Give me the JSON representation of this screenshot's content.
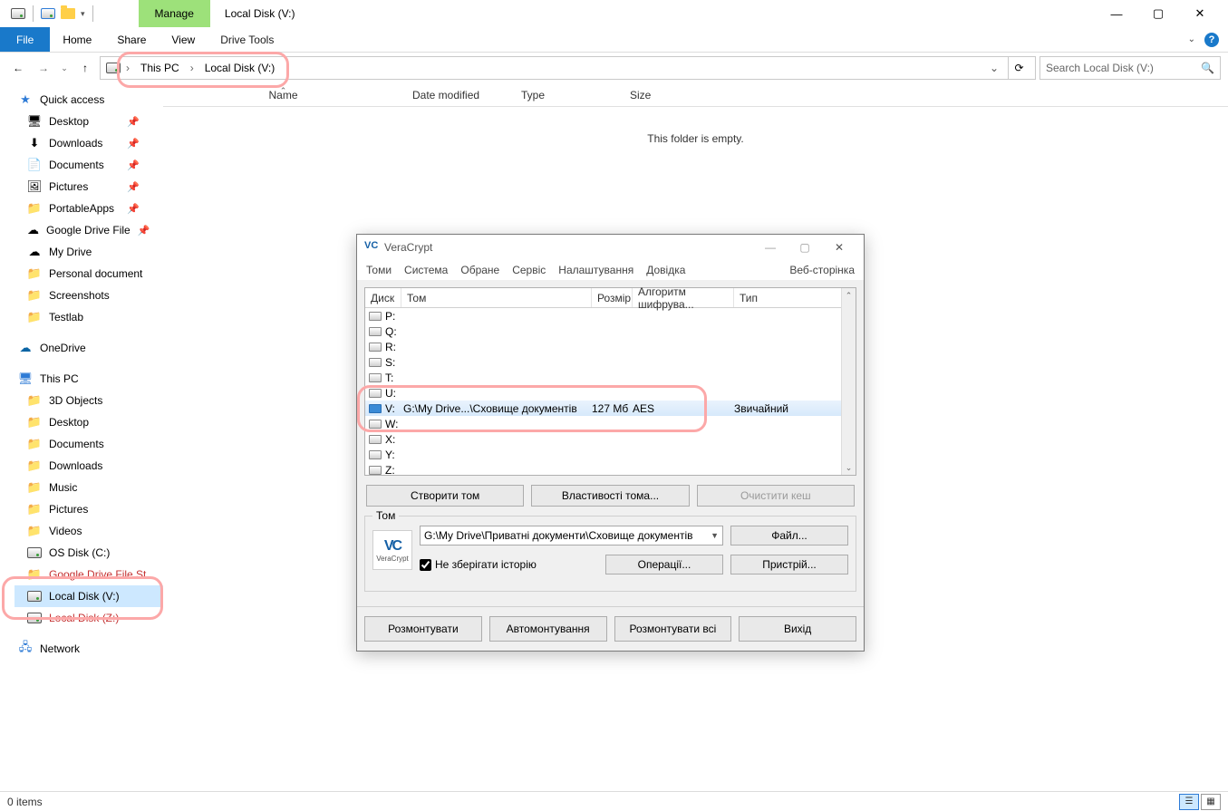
{
  "explorer": {
    "title": "Local Disk (V:)",
    "tabs": {
      "manage": "Manage",
      "file": "File",
      "home": "Home",
      "share": "Share",
      "view": "View",
      "drive_tools": "Drive Tools"
    },
    "breadcrumb": {
      "pc": "This PC",
      "vol": "Local Disk (V:)"
    },
    "search_placeholder": "Search Local Disk (V:)",
    "columns": {
      "name": "Name",
      "date": "Date modified",
      "type": "Type",
      "size": "Size"
    },
    "empty": "This folder is empty.",
    "status": "0 items",
    "sidebar": {
      "quick_access": "Quick access",
      "qa": [
        {
          "label": "Desktop",
          "pin": true,
          "icon": "desktop"
        },
        {
          "label": "Downloads",
          "pin": true,
          "icon": "dl"
        },
        {
          "label": "Documents",
          "pin": true,
          "icon": "doc"
        },
        {
          "label": "Pictures",
          "pin": true,
          "icon": "pic"
        },
        {
          "label": "PortableApps",
          "pin": true,
          "icon": "folder"
        },
        {
          "label": "Google Drive File",
          "pin": true,
          "icon": "gdrive"
        },
        {
          "label": "My Drive",
          "pin": false,
          "icon": "gdrive"
        },
        {
          "label": "Personal document",
          "pin": false,
          "icon": "folder"
        },
        {
          "label": "Screenshots",
          "pin": false,
          "icon": "folder"
        },
        {
          "label": "Testlab",
          "pin": false,
          "icon": "folder"
        }
      ],
      "onedrive": "OneDrive",
      "thispc": "This PC",
      "pc": [
        {
          "label": "3D Objects"
        },
        {
          "label": "Desktop"
        },
        {
          "label": "Documents"
        },
        {
          "label": "Downloads"
        },
        {
          "label": "Music"
        },
        {
          "label": "Pictures"
        },
        {
          "label": "Videos"
        },
        {
          "label": "OS Disk (C:)"
        },
        {
          "label": "Google Drive File St",
          "red": true
        },
        {
          "label": "Local Disk (V:)",
          "sel": true
        },
        {
          "label": "Local Disk (Z:)",
          "red": true
        }
      ],
      "network": "Network"
    }
  },
  "veracrypt": {
    "title": "VeraCrypt",
    "menu": [
      "Томи",
      "Система",
      "Обране",
      "Сервіс",
      "Налаштування",
      "Довідка"
    ],
    "menu_right": "Веб-сторінка",
    "list_headers": {
      "drive": "Диск",
      "vol": "Том",
      "size": "Розмір",
      "algo": "Алгоритм шифрува...",
      "type": "Тип"
    },
    "rows": [
      {
        "letter": "P:"
      },
      {
        "letter": "Q:"
      },
      {
        "letter": "R:"
      },
      {
        "letter": "S:"
      },
      {
        "letter": "T:"
      },
      {
        "letter": "U:"
      },
      {
        "letter": "V:",
        "vol": "G:\\My Drive...\\Сховище документів",
        "size": "127 Мб",
        "algo": "AES",
        "type": "Звичайний",
        "selected": true
      },
      {
        "letter": "W:"
      },
      {
        "letter": "X:"
      },
      {
        "letter": "Y:"
      },
      {
        "letter": "Z:"
      }
    ],
    "btn_create": "Створити том",
    "btn_props": "Властивості тома...",
    "btn_clear": "Очистити кеш",
    "group_legend": "Том",
    "volume_path": "G:\\My Drive\\Приватні документи\\Сховище документів",
    "btn_file": "Файл...",
    "btn_ops": "Операції...",
    "btn_device": "Пристрій...",
    "chk_nohist": "Не зберігати історію",
    "btn_dismount": "Розмонтувати",
    "btn_automount": "Автомонтування",
    "btn_dismount_all": "Розмонтувати всі",
    "btn_exit": "Вихід",
    "logo_text": "VeraCrypt"
  }
}
